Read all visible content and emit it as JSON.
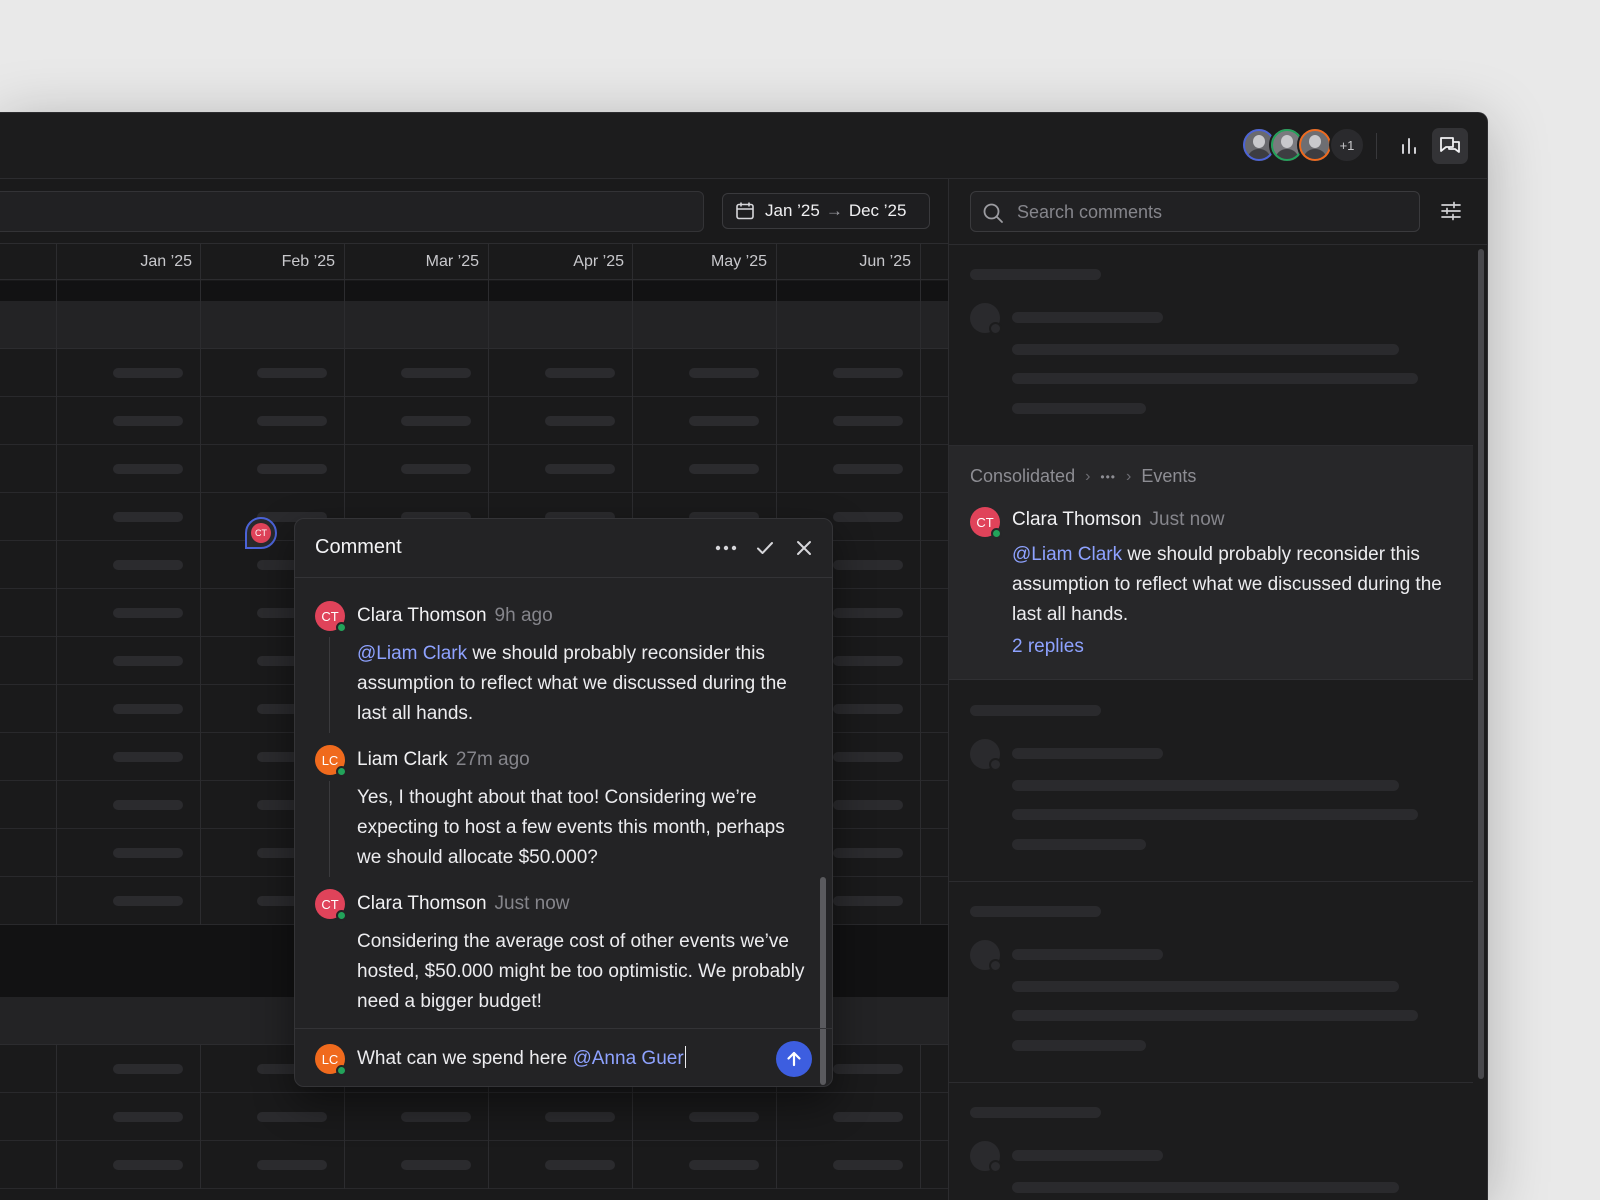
{
  "topbar": {
    "avatars_more": "+1",
    "icons": [
      "chart-icon",
      "comments-icon"
    ]
  },
  "toolbar": {
    "date_start": "Jan ’25",
    "date_arrow": "→",
    "date_end": "Dec ’25"
  },
  "grid": {
    "months": [
      "Jan ’25",
      "Feb ’25",
      "Mar ’25",
      "Apr ’25",
      "May ’25",
      "Jun ’25"
    ]
  },
  "pin": {
    "initials": "CT"
  },
  "popup": {
    "title": "Comment",
    "messages": [
      {
        "initials": "CT",
        "author": "Clara Thomson",
        "time": "9h ago",
        "mention": "@Liam Clark",
        "text": " we should probably reconsider this assumption to reflect what we discussed during the last all hands."
      },
      {
        "initials": "LC",
        "author": "Liam Clark",
        "time": "27m ago",
        "text": "Yes, I thought about that too! Considering we’re expecting to host a few events this month, perhaps we should allocate $50.000?"
      },
      {
        "initials": "CT",
        "author": "Clara Thomson",
        "time": "Just now",
        "text": "Considering the average cost of other events we’ve hosted, $50.000 might be too optimistic. We probably need a bigger budget!"
      }
    ],
    "composer": {
      "initials": "LC",
      "text": "What can we spend here ",
      "mention": "@Anna Guer"
    }
  },
  "right_panel": {
    "search_placeholder": "Search comments",
    "active": {
      "breadcrumb": [
        "Consolidated",
        "•••",
        "Events"
      ],
      "initials": "CT",
      "author": "Clara Thomson",
      "time": "Just now",
      "mention": "@Liam Clark",
      "text": " we should probably reconsider this assumption to reflect what we discussed during the last all hands.",
      "replies": "2 replies"
    }
  },
  "colors": {
    "accent": "#3d5ee0",
    "mention": "#8ea2ff",
    "clara": "#e0435a",
    "liam": "#f06a1d",
    "online": "#22a35a"
  }
}
